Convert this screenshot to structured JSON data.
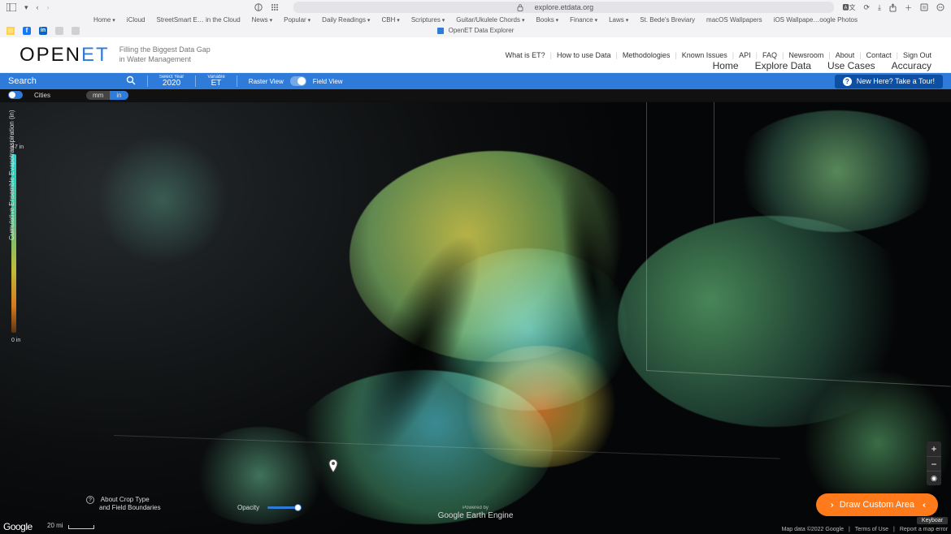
{
  "browser": {
    "url": "explore.etdata.org",
    "bookmarks": [
      {
        "label": "Home",
        "dd": true
      },
      {
        "label": "iCloud",
        "dd": false
      },
      {
        "label": "StreetSmart E… in the Cloud",
        "dd": false
      },
      {
        "label": "News",
        "dd": true
      },
      {
        "label": "Popular",
        "dd": true
      },
      {
        "label": "Daily Readings",
        "dd": true
      },
      {
        "label": "CBH",
        "dd": true
      },
      {
        "label": "Scriptures",
        "dd": true
      },
      {
        "label": "Guitar/Ukulele Chords",
        "dd": true
      },
      {
        "label": "Books",
        "dd": true
      },
      {
        "label": "Finance",
        "dd": true
      },
      {
        "label": "Laws",
        "dd": true
      },
      {
        "label": "St. Bede's Breviary",
        "dd": false
      },
      {
        "label": "macOS Wallpapers",
        "dd": false
      },
      {
        "label": "iOS Wallpape…oogle Photos",
        "dd": false
      }
    ],
    "tab_title": "OpenET Data Explorer"
  },
  "header": {
    "logo_open": "OPEN",
    "logo_et": "ET",
    "tagline1": "Filling the Biggest Data Gap",
    "tagline2": "in Water Management",
    "top_links": [
      "What is ET?",
      "How to use Data",
      "Methodologies",
      "Known Issues",
      "API",
      "FAQ",
      "Newsroom",
      "About",
      "Contact",
      "Sign Out"
    ],
    "main_nav": [
      "Home",
      "Explore Data",
      "Use Cases",
      "Accuracy"
    ]
  },
  "control": {
    "search_label": "Search",
    "year_label": "Select Year",
    "year_value": "2020",
    "var_label": "Variable",
    "var_value": "ET",
    "raster_label": "Raster View",
    "field_label": "Field View",
    "tour_label": "New Here? Take a Tour!"
  },
  "subbar": {
    "cities_label": "Cities",
    "unit_mm": "mm",
    "unit_in": "in"
  },
  "legend": {
    "title": "Cumulative Ensemble Evapotranspiration (in)",
    "max": "47 in",
    "min": "0 in"
  },
  "footer": {
    "about_crop1": "About Crop Type",
    "about_crop2": "and Field Boundaries",
    "opacity_label": "Opacity",
    "scale_label": "20 mi",
    "gee_by": "Powered by",
    "gee": "Google Earth Engine",
    "attrib_data": "Map data ©2022 Google",
    "attrib_terms": "Terms of Use",
    "attrib_report": "Report a map error",
    "google": "Google",
    "kb": "Keyboar"
  },
  "actions": {
    "draw_label": "Draw Custom Area"
  }
}
